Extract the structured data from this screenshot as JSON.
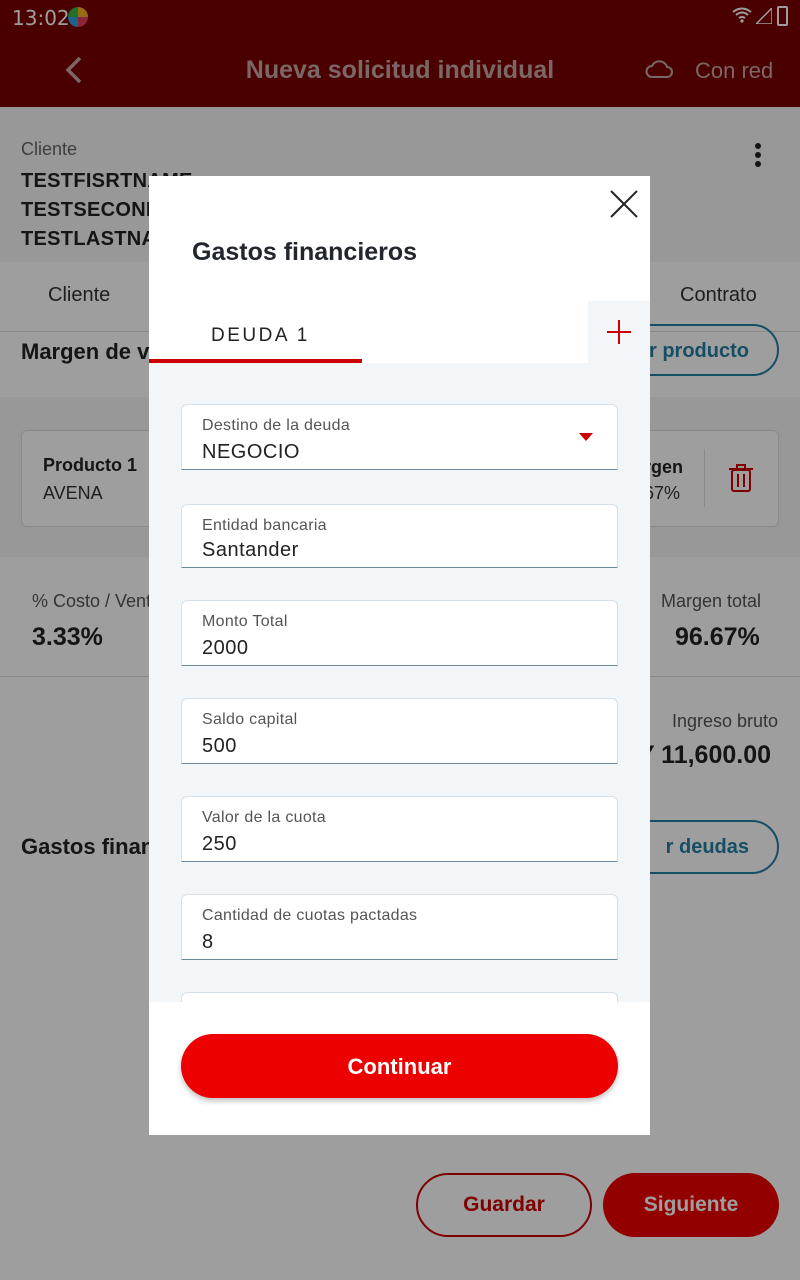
{
  "status_bar": {
    "time": "13:02"
  },
  "app_bar": {
    "title": "Nueva solicitud individual",
    "network": "Con red"
  },
  "client": {
    "label": "Cliente",
    "name": "TESTFISRTNAME TESTSECONDNAME TESTLASTNAME"
  },
  "tabs": {
    "left": "Cliente",
    "right": "Contrato"
  },
  "margin_section": {
    "title": "Margen de ve",
    "add_product": "ar producto"
  },
  "product": {
    "name": "Producto 1",
    "sub": "AVENA",
    "margin_label": "rgen",
    "margin_value": "67%"
  },
  "stats": {
    "cost_label": "% Costo / Vent",
    "cost_value": "3.33%",
    "margin_label": "Margen total",
    "margin_value": "96.67%",
    "income_label": "Ingreso bruto",
    "income_value": "Y 11,600.00"
  },
  "gastos_section": {
    "title": "Gastos financ",
    "add_debt": "r deudas"
  },
  "bottom": {
    "save": "Guardar",
    "next": "Siguiente"
  },
  "modal": {
    "title": "Gastos financieros",
    "tab": "DEUDA 1",
    "fields": [
      {
        "label": "Destino de la deuda",
        "value": "NEGOCIO"
      },
      {
        "label": "Entidad bancaria",
        "value": "Santander"
      },
      {
        "label": "Monto Total",
        "value": "2000"
      },
      {
        "label": "Saldo capital",
        "value": "500"
      },
      {
        "label": "Valor de la cuota",
        "value": "250"
      },
      {
        "label": "Cantidad de cuotas pactadas",
        "value": "8"
      }
    ],
    "continue": "Continuar"
  },
  "colors": {
    "brand_red": "#ec0000",
    "dark_red": "#7a0000",
    "accent_blue": "#257fa4"
  }
}
